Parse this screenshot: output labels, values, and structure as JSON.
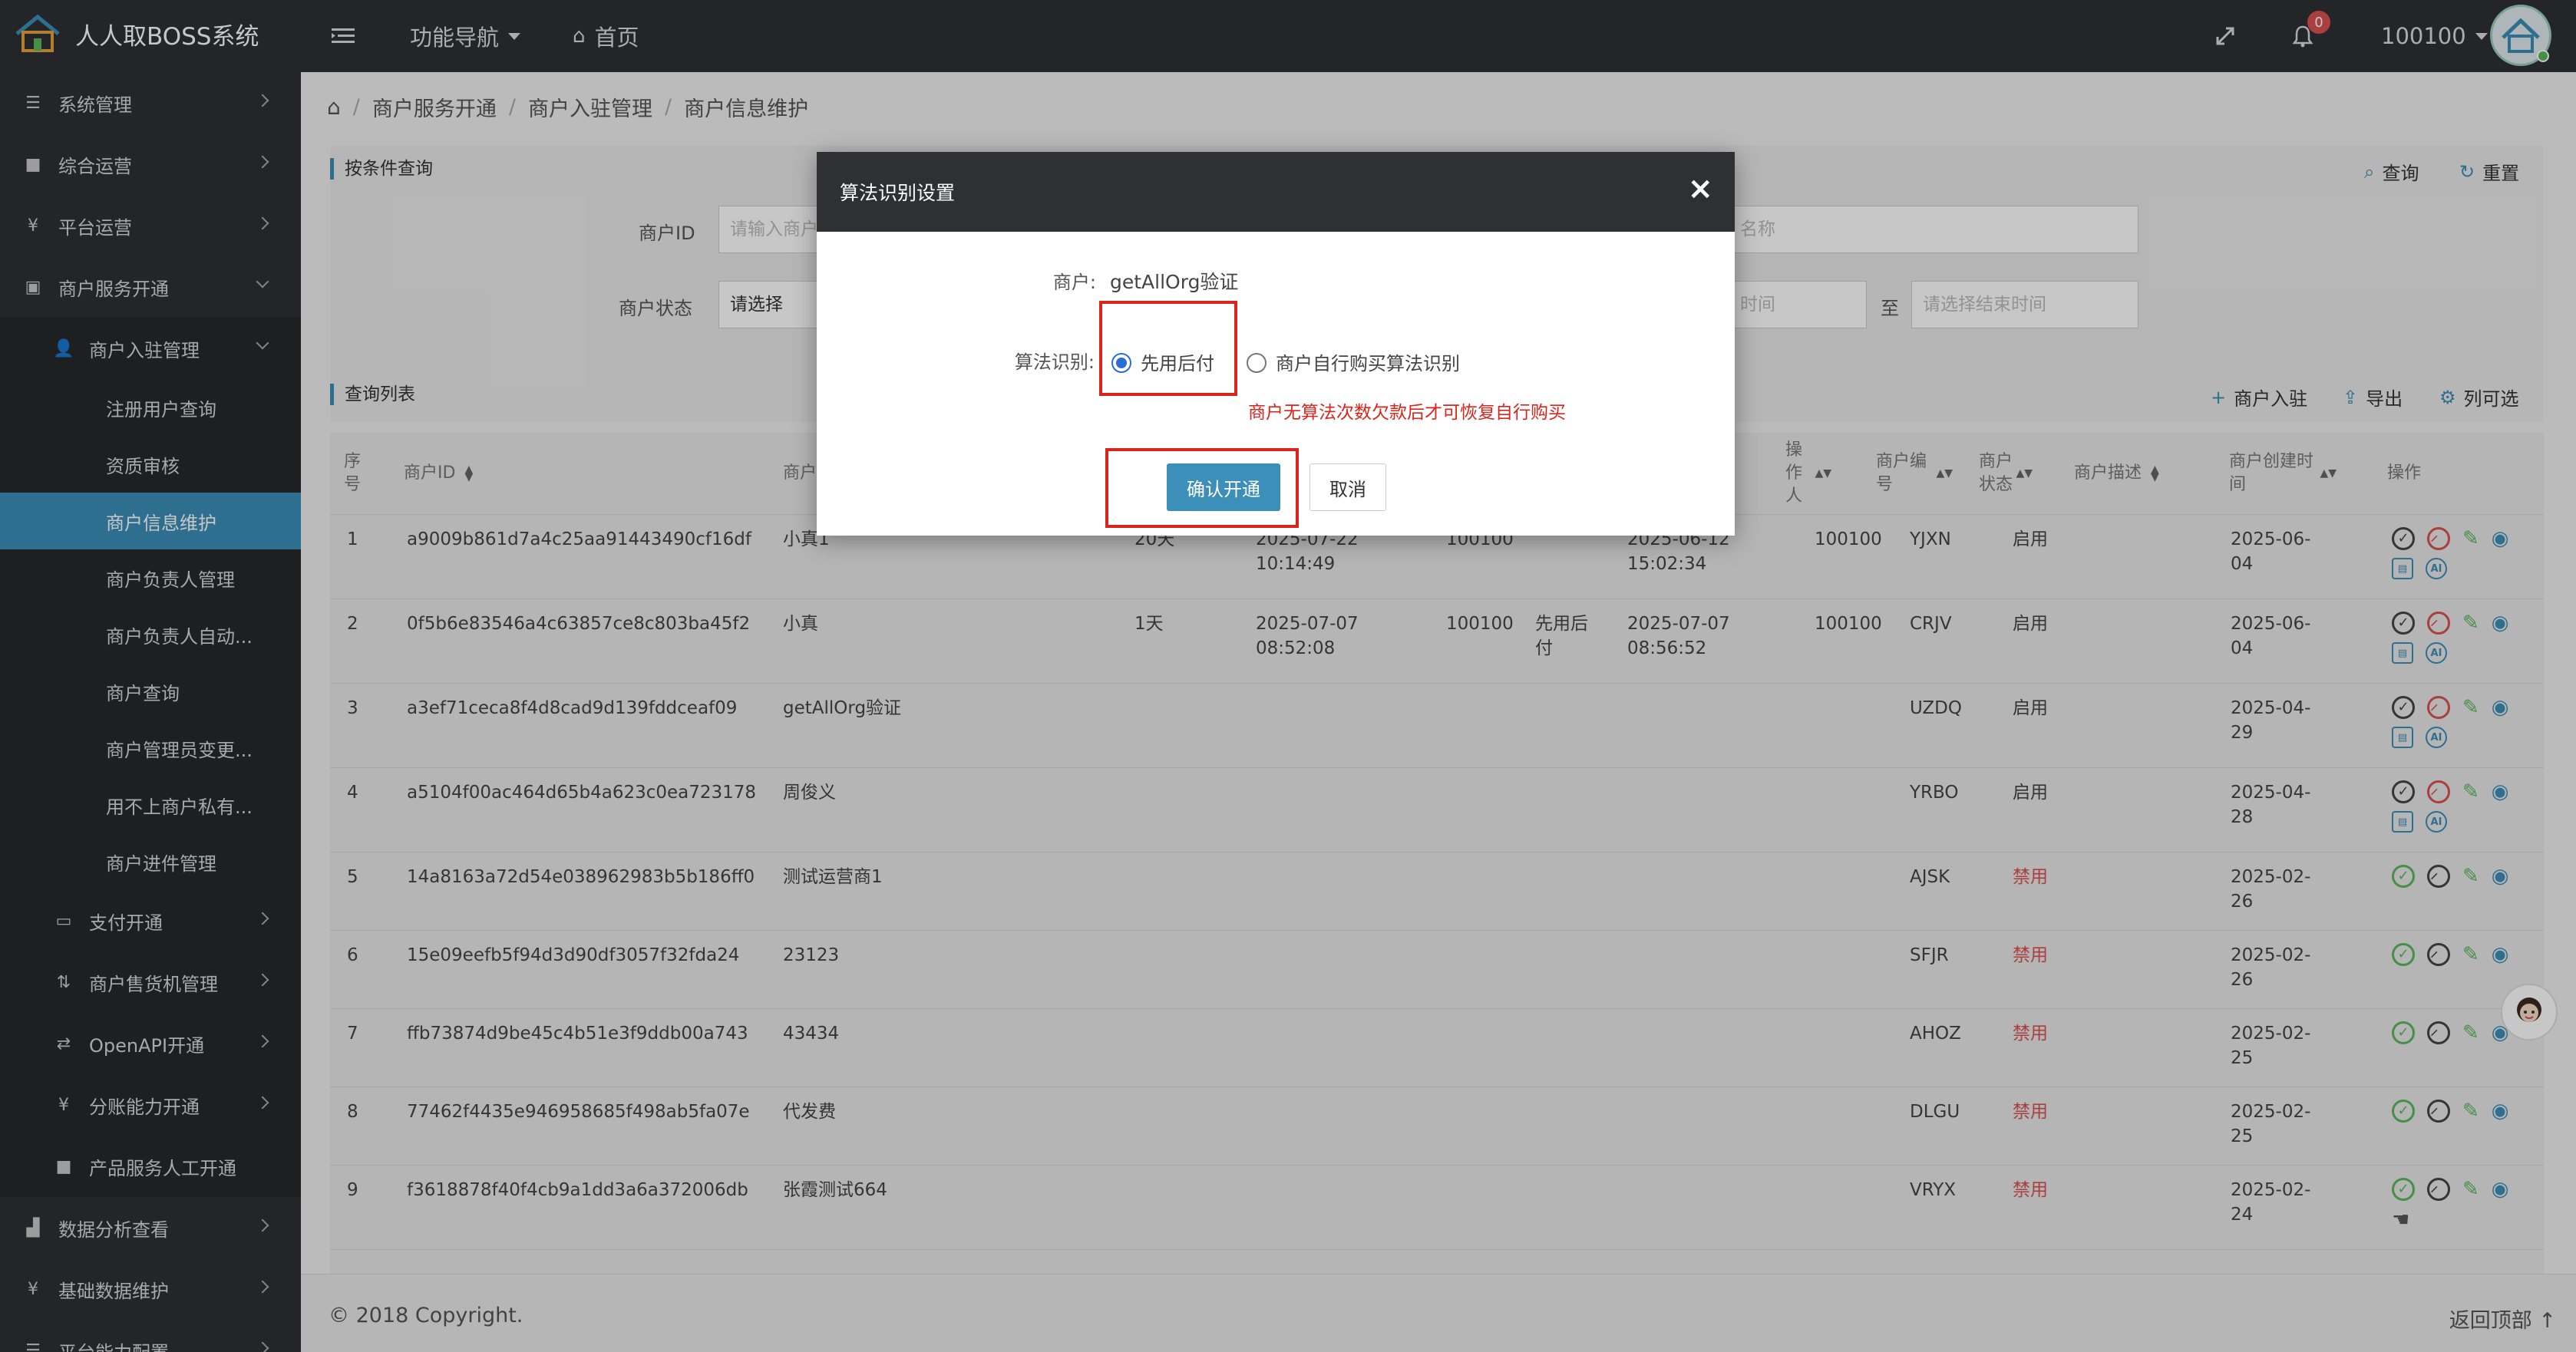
{
  "header": {
    "app_title": "人人取BOSS系统",
    "menu_toggle_icon": "menu-icon",
    "func_nav": "功能导航",
    "home": "首页",
    "notif_count": "0",
    "user": "100100"
  },
  "sidebar": {
    "items": [
      {
        "label": "系统管理",
        "icon": "list-icon"
      },
      {
        "label": "综合运营",
        "icon": "square-icon"
      },
      {
        "label": "平台运营",
        "icon": "yen-icon"
      },
      {
        "label": "商户服务开通",
        "icon": "id-card-icon"
      },
      {
        "label": "商户入驻管理",
        "icon": "user-icon"
      },
      {
        "label": "注册用户查询"
      },
      {
        "label": "资质审核"
      },
      {
        "label": "商户信息维护"
      },
      {
        "label": "商户负责人管理"
      },
      {
        "label": "商户负责人自动..."
      },
      {
        "label": "商户查询"
      },
      {
        "label": "商户管理员变更..."
      },
      {
        "label": "用不上商户私有..."
      },
      {
        "label": "商户进件管理"
      },
      {
        "label": "支付开通",
        "icon": "money-icon"
      },
      {
        "label": "商户售货机管理",
        "icon": "sort-icon"
      },
      {
        "label": "OpenAPI开通",
        "icon": "exchange-icon"
      },
      {
        "label": "分账能力开通",
        "icon": "yen-icon"
      },
      {
        "label": "产品服务人工开通",
        "icon": "square-icon"
      },
      {
        "label": "数据分析查看",
        "icon": "chart-icon"
      },
      {
        "label": "基础数据维护",
        "icon": "yen-icon"
      },
      {
        "label": "平台能力配置",
        "icon": "list-icon"
      }
    ]
  },
  "breadcrumb": [
    "商户服务开通",
    "商户入驻管理",
    "商户信息维护"
  ],
  "search": {
    "title": "按条件查询",
    "query_btn": "查询",
    "reset_btn": "重置",
    "merchant_id_label": "商户ID",
    "merchant_id_placeholder": "请输入商户",
    "merchant_name_placeholder": "名称",
    "status_label": "商户状态",
    "status_value": "请选择",
    "start_time_placeholder": "时间",
    "to_label": "至",
    "end_time_placeholder": "请选择结束时间"
  },
  "list": {
    "title": "查询列表",
    "add_btn": "商户入驻",
    "export_btn": "导出",
    "columns_btn": "列可选",
    "headers": {
      "seq": "序号",
      "merchant_id": "商户ID",
      "merchant_name": "商户",
      "operator": "操作人",
      "code": "商户编号",
      "status": "商户状态",
      "desc": "商户描述",
      "created": "商户创建时间",
      "actions": "操作"
    },
    "rows": [
      {
        "seq": "1",
        "id": "a9009b861d7a4c25aa91443490cf16df",
        "name": "小真1",
        "days": "20天",
        "t1": "2025-07-22 10:14:49",
        "op1": "100100",
        "mode": "",
        "t2": "2025-06-12 15:02:34",
        "op2": "100100",
        "code": "YJXN",
        "status": "启用",
        "created": "2025-06-04"
      },
      {
        "seq": "2",
        "id": "0f5b6e83546a4c63857ce8c803ba45f2",
        "name": "小真",
        "days": "1天",
        "t1": "2025-07-07 08:52:08",
        "op1": "100100",
        "mode": "先用后付",
        "t2": "2025-07-07 08:56:52",
        "op2": "100100",
        "code": "CRJV",
        "status": "启用",
        "created": "2025-06-04"
      },
      {
        "seq": "3",
        "id": "a3ef71ceca8f4d8cad9d139fddceaf09",
        "name": "getAllOrg验证",
        "days": "",
        "t1": "",
        "op1": "",
        "mode": "",
        "t2": "",
        "op2": "",
        "code": "UZDQ",
        "status": "启用",
        "created": "2025-04-29"
      },
      {
        "seq": "4",
        "id": "a5104f00ac464d65b4a623c0ea723178",
        "name": "周俊义",
        "days": "",
        "t1": "",
        "op1": "",
        "mode": "",
        "t2": "",
        "op2": "",
        "code": "YRBO",
        "status": "启用",
        "created": "2025-04-28"
      },
      {
        "seq": "5",
        "id": "14a8163a72d54e038962983b5b186ff0",
        "name": "测试运营商1",
        "days": "",
        "t1": "",
        "op1": "",
        "mode": "",
        "t2": "",
        "op2": "",
        "code": "AJSK",
        "status": "禁用",
        "created": "2025-02-26"
      },
      {
        "seq": "6",
        "id": "15e09eefb5f94d3d90df3057f32fda24",
        "name": "23123",
        "days": "",
        "t1": "",
        "op1": "",
        "mode": "",
        "t2": "",
        "op2": "",
        "code": "SFJR",
        "status": "禁用",
        "created": "2025-02-26"
      },
      {
        "seq": "7",
        "id": "ffb73874d9be45c4b51e3f9ddb00a743",
        "name": "43434",
        "days": "",
        "t1": "",
        "op1": "",
        "mode": "",
        "t2": "",
        "op2": "",
        "code": "AHOZ",
        "status": "禁用",
        "created": "2025-02-25"
      },
      {
        "seq": "8",
        "id": "77462f4435e946958685f498ab5fa07e",
        "name": "代发费",
        "days": "",
        "t1": "",
        "op1": "",
        "mode": "",
        "t2": "",
        "op2": "",
        "code": "DLGU",
        "status": "禁用",
        "created": "2025-02-25"
      },
      {
        "seq": "9",
        "id": "f3618878f40f4cb9a1dd3a6a372006db",
        "name": "张霞测试664",
        "days": "",
        "t1": "",
        "op1": "",
        "mode": "",
        "t2": "",
        "op2": "",
        "code": "VRYX",
        "status": "禁用",
        "created": "2025-02-24"
      }
    ]
  },
  "footer": {
    "copyright": "© 2018 Copyright.",
    "back_top": "返回顶部"
  },
  "modal": {
    "title": "算法识别设置",
    "merchant_label": "商户:",
    "merchant_value": "getAllOrg验证",
    "algo_label": "算法识别:",
    "option1": "先用后付",
    "option2": "商户自行购买算法识别",
    "warning": "商户无算法次数欠款后才可恢复自行购买",
    "confirm": "确认开通",
    "cancel": "取消"
  },
  "colors": {
    "accent": "#3b8fb8",
    "dark": "#2f3034",
    "danger": "#d9534f",
    "highlight": "#d9251c"
  }
}
